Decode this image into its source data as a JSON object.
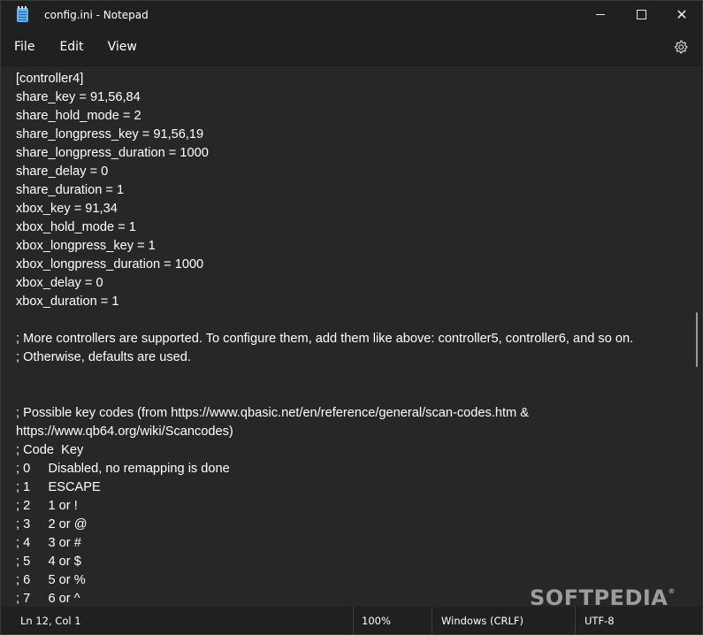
{
  "window": {
    "title": "config.ini - Notepad",
    "minimize_label": "",
    "close_label": "✕"
  },
  "menu": {
    "file": "File",
    "edit": "Edit",
    "view": "View"
  },
  "editor": {
    "lines": [
      "[controller4]",
      "share_key = 91,56,84",
      "share_hold_mode = 2",
      "share_longpress_key = 91,56,19",
      "share_longpress_duration = 1000",
      "share_delay = 0",
      "share_duration = 1",
      "xbox_key = 91,34",
      "xbox_hold_mode = 1",
      "xbox_longpress_key = 1",
      "xbox_longpress_duration = 1000",
      "xbox_delay = 0",
      "xbox_duration = 1",
      "",
      "; More controllers are supported. To configure them, add them like above: controller5, controller6, and so on.",
      "; Otherwise, defaults are used.",
      "",
      "",
      "; Possible key codes (from https://www.qbasic.net/en/reference/general/scan-codes.htm &",
      "https://www.qb64.org/wiki/Scancodes)",
      "; Code  Key",
      "; 0     Disabled, no remapping is done",
      "; 1     ESCAPE",
      "; 2     1 or !",
      "; 3     2 or @",
      "; 4     3 or #",
      "; 5     4 or $",
      "; 6     5 or %",
      "; 7     6 or ^"
    ]
  },
  "status": {
    "position": "Ln 12, Col 1",
    "zoom": "100%",
    "line_ending": "Windows (CRLF)",
    "encoding": "UTF-8"
  },
  "watermark": {
    "text": "SOFTPEDIA",
    "mark": "®"
  },
  "colors": {
    "chrome": "#202020",
    "editor_bg": "#272727",
    "text": "#ffffff",
    "app_icon": "#5fb2f2"
  },
  "icons": {
    "app": "notepad-icon",
    "settings": "gear-icon",
    "minimize": "minimize-icon",
    "maximize": "maximize-icon",
    "close": "close-icon"
  }
}
